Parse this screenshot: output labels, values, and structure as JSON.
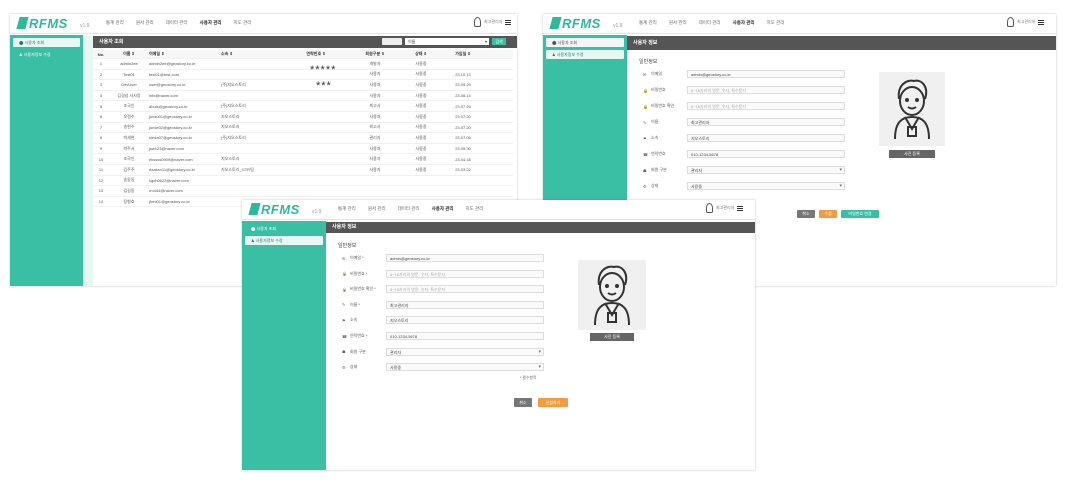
{
  "app": {
    "logo": "RFMS",
    "version": "v1.9",
    "menu": [
      "통계 관리",
      "원서 관리",
      "데이터 관리",
      "사용자 관리",
      "지도 관리"
    ],
    "active_menu": "사용자 관리",
    "user_name": "최고관리자"
  },
  "shot1": {
    "sidebar": [
      "사용자 조회",
      "사용자정보 수정"
    ],
    "page_title": "사용자 조회",
    "search": {
      "filter": "이름",
      "button": "검색"
    },
    "columns": [
      "No.",
      "이름 ⇕",
      "이메일 ⇕",
      "소속 ⇕",
      "연락번호 ⇕",
      "회원구분 ⇕",
      "상태 ⇕",
      "가입일 ⇕"
    ],
    "masks": [
      "*****",
      "***"
    ],
    "rows": [
      [
        "1",
        "admin2ee",
        "admin2ee@geostory.co.kr",
        "",
        "",
        "개발자",
        "사용중",
        ""
      ],
      [
        "2",
        "Test01",
        "test01@test.com",
        "",
        "",
        "사용자",
        "사용중",
        "23.10.13"
      ],
      [
        "3",
        "DevUser",
        "user@geostory.co.kr",
        "(주)지오스토리",
        "",
        "사용자",
        "사용중",
        "23.09.29"
      ],
      [
        "4",
        "김경성 사사랑",
        "info@naver.com",
        "",
        "",
        "사용자",
        "사용중",
        "23.08.14"
      ],
      [
        "5",
        "조국인",
        "dbuls@geostory.co.kr",
        "(주)지오스토리",
        "",
        "최고사",
        "사용중",
        "23.07.25"
      ],
      [
        "6",
        "오정수",
        "junsu01@geostory.co.kr",
        "지오스토리",
        "",
        "사용자",
        "사용중",
        "23.07.20"
      ],
      [
        "7",
        "송현수",
        "junse02@geostory.co.kr",
        "지오스토리",
        "",
        "최고사",
        "사용중",
        "23.07.20"
      ],
      [
        "8",
        "박세현",
        "sieda07@geostory.co.kr",
        "(주)지오스토리",
        "",
        "관리자",
        "사용중",
        "23.07.06"
      ],
      [
        "9",
        "박주서",
        "jsw123@naver.com",
        "",
        "",
        "사용자",
        "사용중",
        "23.05.30"
      ],
      [
        "10",
        "조국인",
        "ekssss0909@naver.com",
        "지오스토리",
        "",
        "사용자",
        "사용중",
        "23.04.18"
      ],
      [
        "11",
        "김주주",
        "rlaaksn11@geostory.co.kr",
        "지오스토리_GTR팀",
        "",
        "사용자",
        "사용중",
        "23.03.22"
      ],
      [
        "12",
        "송동동",
        "kgch0622@naver.com",
        "",
        "",
        "",
        "",
        ""
      ],
      [
        "13",
        "김길동",
        "rm444@naver.com",
        "",
        "",
        "",
        "",
        ""
      ],
      [
        "14",
        "장형호",
        "jhmt01@geostory.co.kr",
        "",
        "",
        "",
        "",
        ""
      ]
    ]
  },
  "shot2": {
    "sidebar": [
      "사용자 조회",
      "사용자정보 수정"
    ],
    "page_title": "사용자 정보",
    "section": "일반정보",
    "fields": [
      {
        "icon": "✉",
        "label": "이메일",
        "value": "admin@geostory.co.kr",
        "placeholder": ""
      },
      {
        "icon": "🔒",
        "label": "비밀번호",
        "value": "",
        "placeholder": "8~16자리의 영문, 숫자, 특수문자"
      },
      {
        "icon": "🔒",
        "label": "비밀번호 확인",
        "value": "",
        "placeholder": "8~16자리의 영문, 숫자, 특수문자"
      },
      {
        "icon": "✎",
        "label": "이름",
        "value": "최고관리자",
        "placeholder": ""
      },
      {
        "icon": "⚑",
        "label": "소속",
        "value": "지오스토리",
        "placeholder": ""
      },
      {
        "icon": "☎",
        "label": "연락번호",
        "value": "010-1234-5678",
        "placeholder": ""
      },
      {
        "icon": "☗",
        "label": "회원 구분",
        "value": "관리자",
        "placeholder": ""
      },
      {
        "icon": "⚙",
        "label": "상태",
        "value": "사용중",
        "placeholder": ""
      }
    ],
    "photo_button": "사진 등록",
    "buttons": [
      "취소",
      "수정",
      "비밀번호 변경"
    ]
  },
  "shot3": {
    "sidebar": [
      "사용자 조회",
      "사용자정보 수정"
    ],
    "page_title": "사용자 정보",
    "section": "일반정보",
    "fields": [
      {
        "icon": "✉",
        "label": "이메일 *",
        "value": "admin@geostory.co.kr",
        "placeholder": ""
      },
      {
        "icon": "🔒",
        "label": "비밀번호 *",
        "value": "",
        "placeholder": "8~16자리의 영문, 숫자, 특수문자"
      },
      {
        "icon": "🔒",
        "label": "비밀번호 확인 *",
        "value": "",
        "placeholder": "8~16자리의 영문, 숫자, 특수문자"
      },
      {
        "icon": "✎",
        "label": "이름 *",
        "value": "최고관리자",
        "placeholder": ""
      },
      {
        "icon": "⚑",
        "label": "소속",
        "value": "지오스토리",
        "placeholder": ""
      },
      {
        "icon": "☎",
        "label": "연락번호 *",
        "value": "010-1234-5678",
        "placeholder": ""
      },
      {
        "icon": "☗",
        "label": "회원 구분",
        "value": "관리자",
        "placeholder": ""
      },
      {
        "icon": "⚙",
        "label": "상태",
        "value": "사용중",
        "placeholder": ""
      }
    ],
    "required_note": "* 필수항목",
    "photo_button": "사진 등록",
    "buttons": [
      "취소",
      "신청하기"
    ]
  }
}
